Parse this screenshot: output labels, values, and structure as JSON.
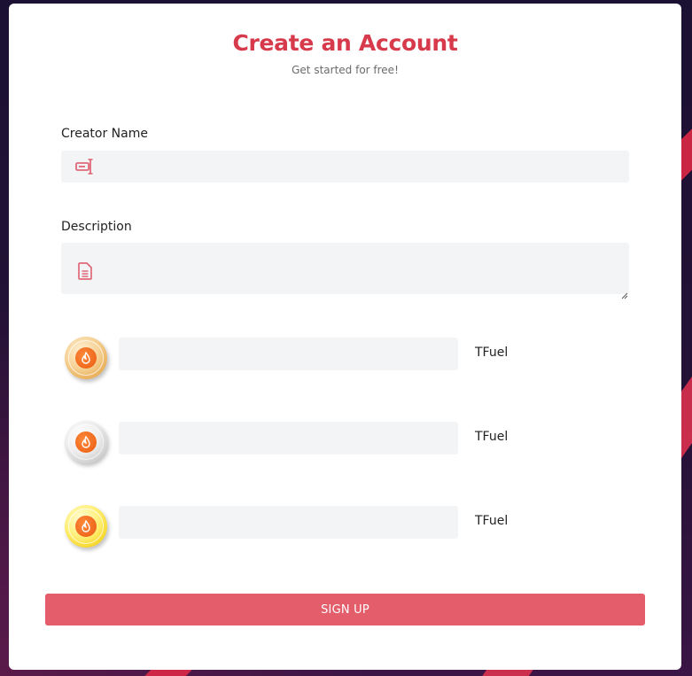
{
  "header": {
    "title": "Create an Account",
    "subtitle": "Get started for free!"
  },
  "form": {
    "creator_name": {
      "label": "Creator Name",
      "value": "",
      "icon": "text-field-icon"
    },
    "description": {
      "label": "Description",
      "value": "",
      "icon": "document-icon"
    },
    "tiers": [
      {
        "coin": "bronze-coin-icon",
        "value": "",
        "unit": "TFuel"
      },
      {
        "coin": "silver-coin-icon",
        "value": "",
        "unit": "TFuel"
      },
      {
        "coin": "gold-coin-icon",
        "value": "",
        "unit": "TFuel"
      }
    ],
    "submit_label": "SIGN UP"
  },
  "colors": {
    "accent": "#d63a4b",
    "button": "#e35d6a",
    "field_bg": "#f3f4f6"
  }
}
